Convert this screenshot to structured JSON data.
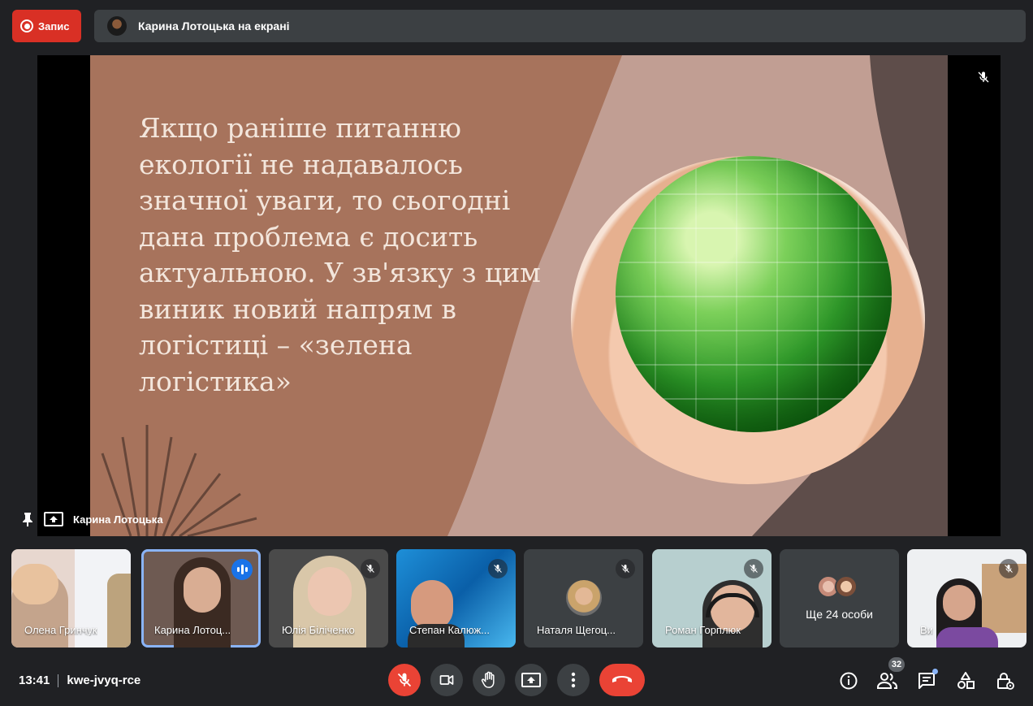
{
  "recording": {
    "label": "Запис"
  },
  "presenting": {
    "label": "Карина Лотоцька на екрані"
  },
  "slide": {
    "text": "Якщо раніше питанню\nекології не надавалось\nзначної уваги, то сьогодні\nдана проблема є досить\nактуальною. У зв'язку з цим\nвиник новий напрям в\nлогістиці – «зелена\nлогістика»"
  },
  "stage": {
    "presenter_name": "Карина Лотоцька"
  },
  "participants": [
    {
      "name": "Олена Гринчук",
      "state": "muted-hidden"
    },
    {
      "name": "Карина Лотоц...",
      "state": "speaking"
    },
    {
      "name": "Юлія Біліченко",
      "state": "muted"
    },
    {
      "name": "Степан Калюж...",
      "state": "muted"
    },
    {
      "name": "Наталя Щегоц...",
      "state": "muted"
    },
    {
      "name": "Роман Горплюк",
      "state": "muted"
    },
    {
      "name": "Ще 24 особи",
      "state": "overflow"
    },
    {
      "name": "Ви",
      "state": "muted"
    }
  ],
  "footer": {
    "time": "13:41",
    "meeting_code": "kwe-jvyq-rce",
    "participant_count": "32"
  },
  "colors": {
    "accent_red": "#ea4335",
    "speaking_blue": "#1a73e8",
    "bar_gray": "#3c4043"
  },
  "icons": [
    "record-icon",
    "mic-off-icon",
    "camera-icon",
    "raise-hand-icon",
    "present-icon",
    "more-vert-icon",
    "call-end-icon",
    "info-icon",
    "people-icon",
    "chat-icon",
    "activities-icon",
    "host-controls-icon",
    "pin-icon"
  ]
}
